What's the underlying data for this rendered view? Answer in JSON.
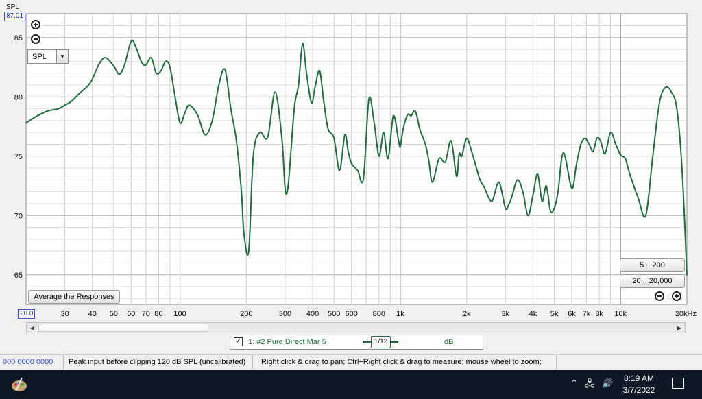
{
  "window": {
    "y_unit_label": "SPL",
    "y_max_value": "87.01",
    "x_min_value": "20.0",
    "measurement_select": "SPL",
    "average_button": "Average the Responses",
    "range_buttons": [
      "5 .. 200",
      "20 .. 20,000"
    ]
  },
  "legend": {
    "checked": true,
    "name": "1: #2 Pure Direct Mar 5",
    "smoothing": "1/12",
    "units": "dB"
  },
  "statusbar": {
    "counter": "000  0000 0000",
    "peak_input": "Peak input before clipping 120 dB SPL (uncalibrated)",
    "hint": "Right click & drag to pan; Ctrl+Right click & drag to measure; mouse wheel to zoom;"
  },
  "taskbar": {
    "time": "8:19 AM",
    "date": "3/7/2022"
  },
  "colors": {
    "trace": "#1d6e3b",
    "axis_box": "#3a4fd0"
  },
  "chart_data": {
    "type": "line",
    "x_scale": "log",
    "xlim": [
      20,
      20000
    ],
    "ylim": [
      62.5,
      87.01
    ],
    "x_tick_labels": [
      {
        "v": 30,
        "t": "30"
      },
      {
        "v": 40,
        "t": "40"
      },
      {
        "v": 50,
        "t": "50"
      },
      {
        "v": 60,
        "t": "60"
      },
      {
        "v": 70,
        "t": "70"
      },
      {
        "v": 80,
        "t": "80"
      },
      {
        "v": 100,
        "t": "100"
      },
      {
        "v": 200,
        "t": "200"
      },
      {
        "v": 300,
        "t": "300"
      },
      {
        "v": 400,
        "t": "400"
      },
      {
        "v": 500,
        "t": "500"
      },
      {
        "v": 600,
        "t": "600"
      },
      {
        "v": 800,
        "t": "800"
      },
      {
        "v": 1000,
        "t": "1k"
      },
      {
        "v": 2000,
        "t": "2k"
      },
      {
        "v": 3000,
        "t": "3k"
      },
      {
        "v": 4000,
        "t": "4k"
      },
      {
        "v": 5000,
        "t": "5k"
      },
      {
        "v": 6000,
        "t": "6k"
      },
      {
        "v": 7000,
        "t": "7k"
      },
      {
        "v": 8000,
        "t": "8k"
      },
      {
        "v": 10000,
        "t": "10k"
      },
      {
        "v": 20000,
        "t": "20kHz"
      }
    ],
    "y_ticks": [
      65,
      70,
      75,
      80,
      85
    ],
    "grid": true,
    "series": [
      {
        "x": [
          20,
          22,
          25,
          28,
          30,
          32,
          35,
          38,
          40,
          43,
          46,
          50,
          53,
          56,
          60,
          63,
          67,
          70,
          74,
          78,
          82,
          86,
          90,
          95,
          100,
          105,
          110,
          120,
          130,
          140,
          150,
          160,
          170,
          180,
          190,
          195,
          205,
          215,
          230,
          250,
          270,
          290,
          300,
          310,
          330,
          345,
          360,
          375,
          395,
          410,
          430,
          450,
          470,
          500,
          530,
          560,
          580,
          600,
          640,
          680,
          720,
          760,
          800,
          840,
          880,
          930,
          980,
          1000,
          1030,
          1080,
          1120,
          1170,
          1230,
          1300,
          1350,
          1400,
          1500,
          1600,
          1700,
          1800,
          1850,
          1900,
          2000,
          2100,
          2200,
          2300,
          2400,
          2600,
          2800,
          3000,
          3100,
          3200,
          3400,
          3600,
          3800,
          4000,
          4200,
          4400,
          4600,
          4800,
          5000,
          5200,
          5500,
          6000,
          6300,
          6600,
          6900,
          7200,
          7500,
          7800,
          8100,
          8500,
          9000,
          9500,
          10000,
          10500,
          11000,
          12000,
          13000,
          14000,
          15000,
          16000,
          17000,
          18000,
          19000,
          20000
        ],
        "y": [
          77.8,
          78.3,
          78.8,
          79.0,
          79.3,
          79.6,
          80.3,
          80.9,
          81.5,
          82.8,
          83.3,
          82.6,
          81.9,
          82.7,
          84.7,
          84.2,
          82.9,
          82.7,
          83.3,
          82.0,
          82.2,
          83.0,
          82.5,
          80.0,
          77.8,
          78.6,
          79.3,
          78.5,
          76.8,
          78.0,
          81.0,
          82.3,
          79.0,
          76.4,
          72.0,
          68.5,
          67.0,
          75.0,
          77.0,
          76.6,
          80.4,
          76.5,
          72.3,
          72.6,
          79.0,
          81.0,
          84.5,
          82.0,
          79.5,
          80.8,
          82.2,
          79.5,
          77.3,
          76.5,
          73.8,
          76.8,
          75.4,
          74.4,
          73.8,
          73.1,
          79.8,
          77.9,
          75.0,
          77.0,
          74.8,
          78.4,
          76.4,
          75.8,
          77.3,
          78.5,
          78.4,
          78.8,
          77.2,
          76.0,
          74.5,
          72.8,
          74.8,
          74.5,
          76.3,
          73.3,
          75.2,
          75.0,
          76.5,
          75.5,
          74.2,
          73.0,
          72.4,
          71.2,
          72.8,
          70.6,
          70.9,
          71.5,
          73.0,
          72.0,
          70.0,
          71.7,
          73.5,
          71.2,
          72.5,
          70.4,
          70.6,
          72.0,
          75.3,
          72.3,
          74.3,
          76.0,
          76.5,
          76.0,
          75.4,
          76.5,
          76.3,
          75.2,
          77.0,
          76.0,
          75.1,
          74.8,
          73.5,
          71.5,
          70.0,
          75.0,
          79.5,
          80.8,
          80.4,
          79.0,
          74.0,
          65.0
        ]
      }
    ]
  }
}
